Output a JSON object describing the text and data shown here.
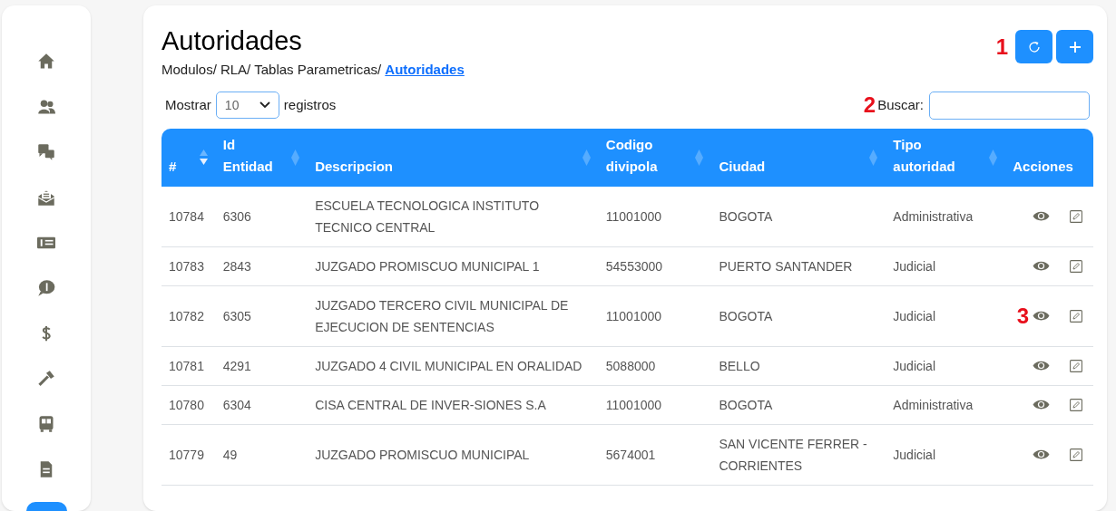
{
  "sidebar": {
    "items": [
      {
        "selected": false
      },
      {
        "selected": false
      },
      {
        "selected": false
      },
      {
        "selected": false
      },
      {
        "selected": false
      },
      {
        "selected": false
      },
      {
        "selected": false
      },
      {
        "selected": false
      },
      {
        "selected": false
      },
      {
        "selected": false
      },
      {
        "selected": true
      }
    ]
  },
  "page": {
    "title": "Autoridades",
    "breadcrumb": [
      "Modulos/",
      "RLA/",
      "Tablas Parametricas/"
    ],
    "breadcrumb_current": "Autoridades",
    "marker": "1"
  },
  "length_control": {
    "label_before": "Mostrar",
    "value": "10",
    "label_after": "registros"
  },
  "search": {
    "label": "Buscar:",
    "marker": "2"
  },
  "table": {
    "columns": [
      {
        "label": "#",
        "sorted": true
      },
      {
        "label": "Id Entidad",
        "sorted": false
      },
      {
        "label": "Descripcion",
        "sorted": false
      },
      {
        "label": "Codigo divipola",
        "sorted": false
      },
      {
        "label": "Ciudad",
        "sorted": false
      },
      {
        "label": "Tipo autoridad",
        "sorted": false
      },
      {
        "label": "Acciones"
      }
    ],
    "rows": [
      {
        "cells": [
          "10784",
          "6306",
          "ESCUELA TECNOLOGICA INSTITUTO TECNICO CENTRAL",
          "11001000",
          "BOGOTA",
          "Administrativa"
        ]
      },
      {
        "cells": [
          "10783",
          "2843",
          "JUZGADO PROMISCUO MUNICIPAL 1",
          "54553000",
          "PUERTO SANTANDER",
          "Judicial"
        ]
      },
      {
        "cells": [
          "10782",
          "6305",
          "JUZGADO TERCERO CIVIL MUNICIPAL DE EJECUCION DE SENTENCIAS",
          "11001000",
          "BOGOTA",
          "Judicial"
        ],
        "marker": "3"
      },
      {
        "cells": [
          "10781",
          "4291",
          "JUZGADO 4 CIVIL MUNICIPAL EN ORALIDAD",
          "5088000",
          "BELLO",
          "Judicial"
        ]
      },
      {
        "cells": [
          "10780",
          "6304",
          "CISA CENTRAL DE INVER-SIONES S.A",
          "11001000",
          "BOGOTA",
          "Administrativa"
        ]
      },
      {
        "cells": [
          "10779",
          "49",
          "JUZGADO PROMISCUO MUNICIPAL",
          "5674001",
          "SAN VICENTE FERRER - CORRIENTES",
          "Judicial"
        ]
      }
    ]
  }
}
